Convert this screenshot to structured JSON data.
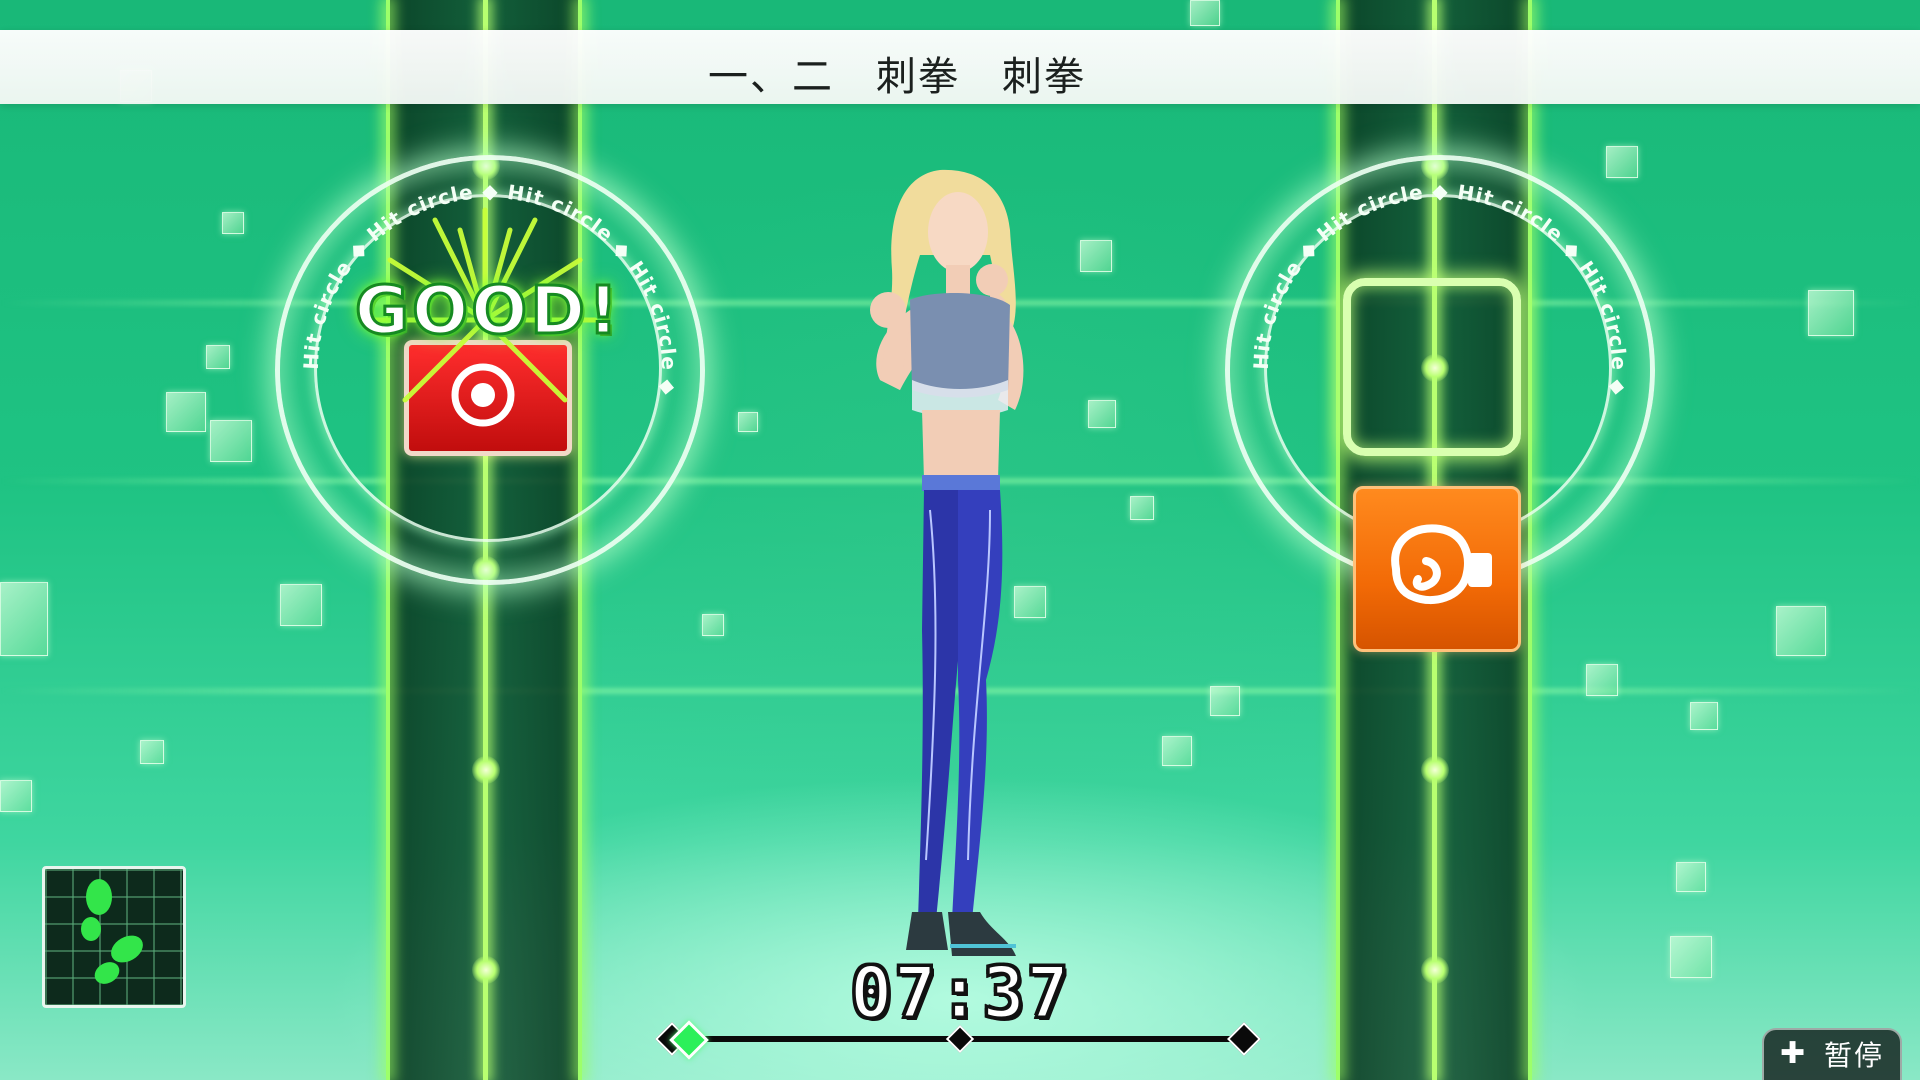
{
  "banner": {
    "text": "一、二　刺拳　刺拳"
  },
  "hit_circle": {
    "text": "Hit circle ◆ Hit circle ◆ Hit circle ◆ Hit circle ◆ "
  },
  "feedback": {
    "rating": "GOOD!"
  },
  "timer": {
    "value": "07:37",
    "progress": 0.03
  },
  "pause": {
    "icon": "plus-icon",
    "label": "暂停"
  },
  "colors": {
    "background": "#1fc383",
    "lane": "#124d2f",
    "accent_green": "#9dff6a",
    "target_red": "#e51b1b",
    "glove_orange": "#f26a06"
  },
  "icons": {
    "left_target": "punch-impact-icon",
    "right_target": "boxing-glove-icon",
    "footwork": "footsteps-icon"
  }
}
